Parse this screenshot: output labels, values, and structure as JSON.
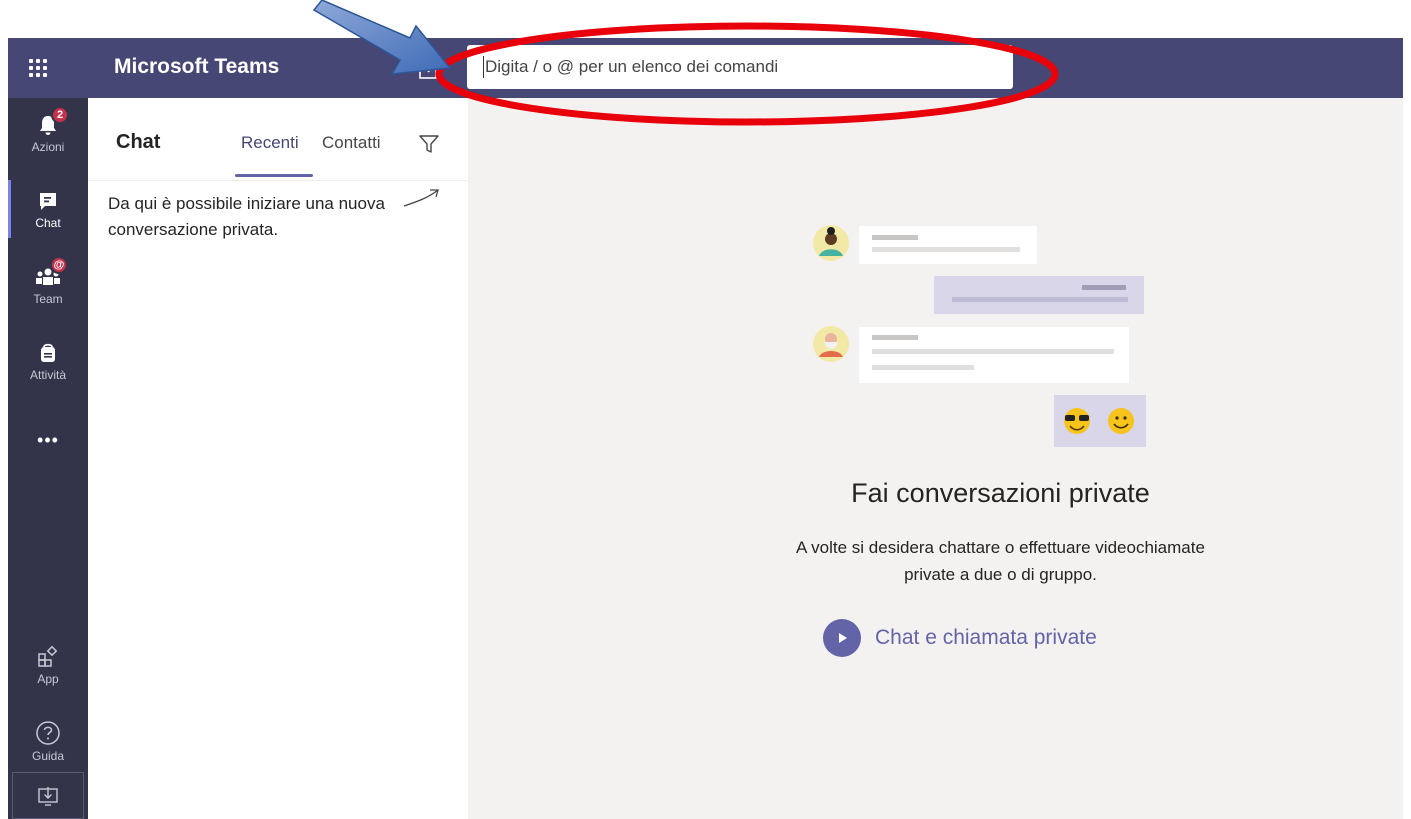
{
  "topbar": {
    "app_title": "Microsoft Teams",
    "search_placeholder": "Digita / o @ per un elenco dei comandi",
    "background": "#464775"
  },
  "rail": {
    "items": [
      {
        "label": "Azioni",
        "icon": "bell-icon",
        "badge": "2"
      },
      {
        "label": "Chat",
        "icon": "chat-icon",
        "active": true
      },
      {
        "label": "Team",
        "icon": "teams-icon",
        "badge": "@"
      },
      {
        "label": "Attività",
        "icon": "backpack-icon"
      },
      {
        "label": "App",
        "icon": "apps-icon"
      },
      {
        "label": "Guida",
        "icon": "help-icon"
      }
    ],
    "more_label": "•••"
  },
  "chat_list": {
    "title": "Chat",
    "tabs": [
      {
        "label": "Recenti",
        "active": true
      },
      {
        "label": "Contatti",
        "active": false
      }
    ],
    "hint": "Da qui è possibile iniziare una nuova conversazione privata."
  },
  "main": {
    "title": "Fai conversazioni private",
    "description_line1": "A volte si desidera chattare o effettuare videochiamate",
    "description_line2": "private a due o di gruppo.",
    "cta_label": "Chat e chiamata private"
  },
  "colors": {
    "accent": "#6264a7",
    "rail": "#33344a",
    "badge": "#c4314b",
    "annotation_ellipse": "#e8000b",
    "annotation_arrow": "#4472c4"
  }
}
